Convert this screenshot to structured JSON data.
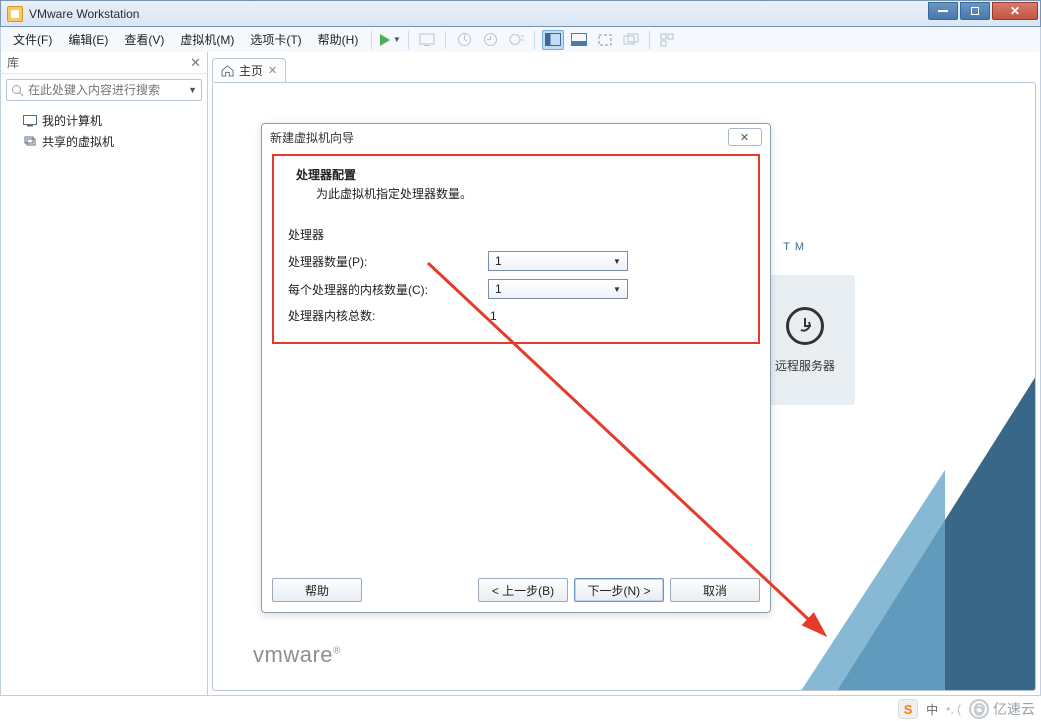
{
  "title": "VMware Workstation",
  "menu": {
    "file": "文件(F)",
    "edit": "编辑(E)",
    "view": "查看(V)",
    "vm": "虚拟机(M)",
    "tabs": "选项卡(T)",
    "help": "帮助(H)"
  },
  "sidebar": {
    "header": "库",
    "search_placeholder": "在此处键入内容进行搜索",
    "items": {
      "my_computer": "我的计算机",
      "shared_vms": "共享的虚拟机"
    }
  },
  "tabs": {
    "home": "主页"
  },
  "home": {
    "tm": "T M",
    "server_card": "远程服务器",
    "logo_a": "vm",
    "logo_b": "ware"
  },
  "wizard": {
    "title": "新建虚拟机向导",
    "section_title": "处理器配置",
    "section_sub": "为此虚拟机指定处理器数量。",
    "group_header": "处理器",
    "row_processors_label": "处理器数量(P):",
    "row_processors_value": "1",
    "row_cores_label": "每个处理器的内核数量(C):",
    "row_cores_value": "1",
    "row_total_label": "处理器内核总数:",
    "row_total_value": "1",
    "btn_help": "帮助",
    "btn_back": "< 上一步(B)",
    "btn_next": "下一步(N) >",
    "btn_cancel": "取消"
  },
  "overlay": {
    "sogou": "S",
    "ime": "中",
    "yisu": "亿速云"
  }
}
